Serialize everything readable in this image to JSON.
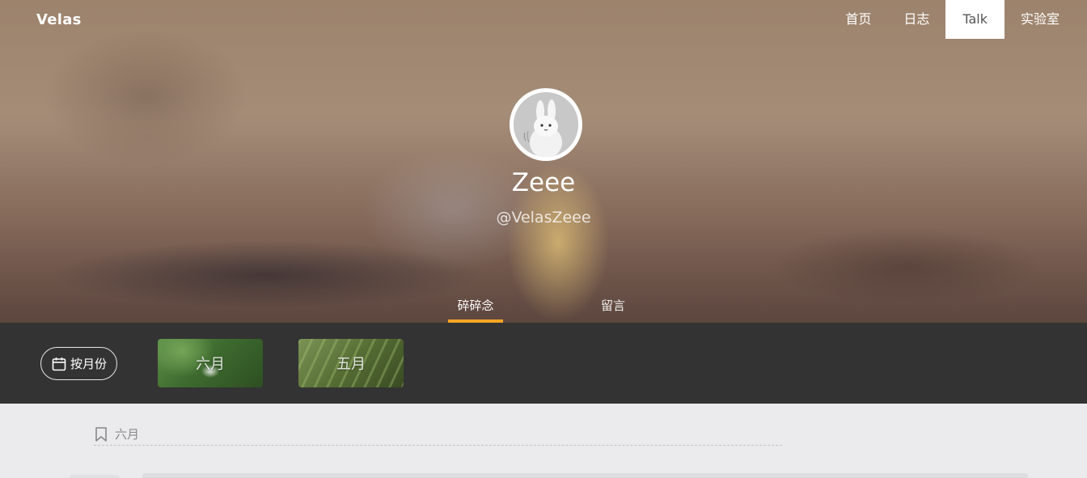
{
  "header": {
    "brand": "Velas",
    "nav": [
      {
        "label": "首页"
      },
      {
        "label": "日志"
      },
      {
        "label": "Talk",
        "active": true
      },
      {
        "label": "实验室"
      }
    ]
  },
  "profile": {
    "name": "Zeee",
    "handle": "@VelasZeee"
  },
  "tabs": [
    {
      "label": "碎碎念",
      "active": true
    },
    {
      "label": "留言"
    }
  ],
  "filter_bar": {
    "month_button_label": "按月份",
    "months": [
      {
        "label": "六月"
      },
      {
        "label": "五月"
      }
    ]
  },
  "content": {
    "section_title": "六月"
  },
  "colors": {
    "accent": "#f6a623",
    "dark_bar": "#333333",
    "page_bg": "#ebebed"
  },
  "icons": [
    "calendar-icon",
    "bookmark-icon"
  ]
}
